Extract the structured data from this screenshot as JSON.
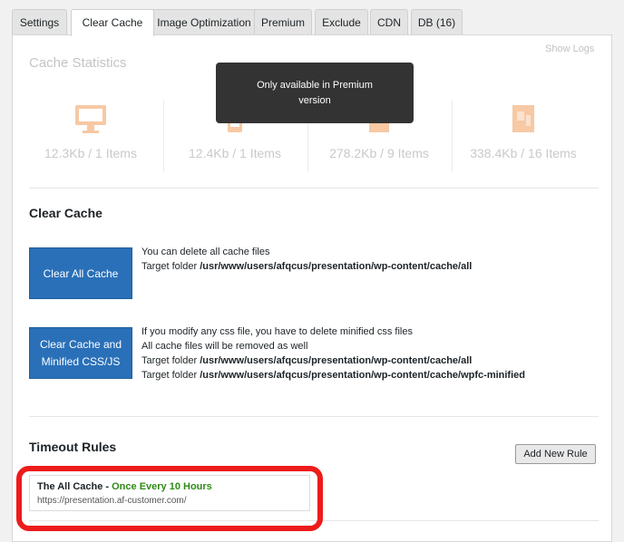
{
  "tabs": [
    {
      "label": "Settings",
      "active": false
    },
    {
      "label": "Clear Cache",
      "active": true
    },
    {
      "label": "Image Optimization",
      "active": false
    },
    {
      "label": "Premium",
      "active": false
    },
    {
      "label": "Exclude",
      "active": false
    },
    {
      "label": "CDN",
      "active": false
    },
    {
      "label": "DB (16)",
      "active": false
    }
  ],
  "show_logs": "Show Logs",
  "stats": {
    "title": "Cache Statistics",
    "items": [
      {
        "icon": "desktop-icon",
        "value": "12.3Kb / 1 Items"
      },
      {
        "icon": "mobile-icon",
        "value": "12.4Kb / 1 Items"
      },
      {
        "icon": "css-file-icon",
        "value": "278.2Kb / 9 Items"
      },
      {
        "icon": "js-file-icon",
        "value": "338.4Kb / 16 Items"
      }
    ],
    "icon_color": "#f7c9a4"
  },
  "tooltip": {
    "line1": "Only available in Premium",
    "line2": "version"
  },
  "clear_cache": {
    "title": "Clear Cache",
    "clear_all_label": "Clear All Cache",
    "clear_all_desc": {
      "line1": "You can delete all cache files",
      "prefix": "Target folder ",
      "path": "/usr/www/users/afqcus/presentation/wp-content/cache/all"
    },
    "clear_minified_label_1": "Clear Cache and",
    "clear_minified_label_2": "Minified CSS/JS",
    "clear_minified_desc": {
      "line1": "If you modify any css file, you have to delete minified css files",
      "line2": "All cache files will be removed as well",
      "prefix": "Target folder ",
      "path1": "/usr/www/users/afqcus/presentation/wp-content/cache/all",
      "path2": "/usr/www/users/afqcus/presentation/wp-content/cache/wpfc-minified"
    }
  },
  "timeout": {
    "title": "Timeout Rules",
    "add_rule": "Add New Rule",
    "rule": {
      "name": "The All Cache",
      "separator": " - ",
      "frequency": "Once Every 10 Hours",
      "url": "https://presentation.af-customer.com/"
    }
  },
  "colors": {
    "primary_button": "#2a70b8",
    "annotation": "#ee1b1b",
    "frequency": "#2e8b16"
  }
}
